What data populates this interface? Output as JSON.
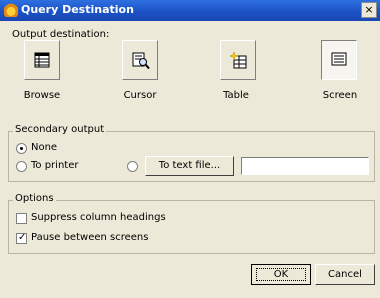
{
  "window": {
    "title": "Query Destination",
    "close_glyph": "×"
  },
  "output_destination": {
    "label": "Output destination:",
    "buttons": [
      {
        "label": "Browse",
        "icon": "browse-grid-icon"
      },
      {
        "label": "Cursor",
        "icon": "cursor-magnifier-icon"
      },
      {
        "label": "Table",
        "icon": "table-new-icon"
      },
      {
        "label": "Screen",
        "icon": "screen-icon",
        "pressed": true
      }
    ]
  },
  "secondary_output": {
    "label": "Secondary output",
    "none_label": "None",
    "printer_label": "To printer",
    "text_file_button": "To text file...",
    "text_file_value": "",
    "selected": "None"
  },
  "options": {
    "label": "Options",
    "suppress_headings": {
      "label": "Suppress column headings",
      "checked": false
    },
    "pause_screens": {
      "label": "Pause between screens",
      "checked": true,
      "mark": "✓"
    }
  },
  "footer": {
    "ok_label": "OK",
    "cancel_label": "Cancel"
  }
}
